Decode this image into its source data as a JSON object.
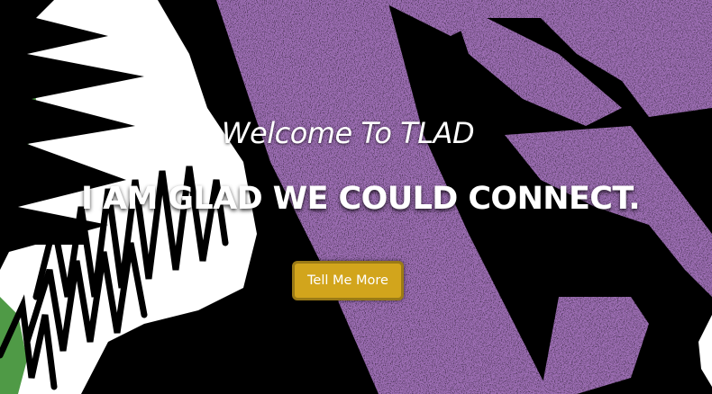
{
  "hero": {
    "welcome_text": "Welcome To TLAD",
    "headline": "I AM GLAD WE COULD CONNECT.",
    "cta_label": "Tell Me More"
  },
  "colors": {
    "purple": "#9e6fb5",
    "green": "#4f9a46",
    "white": "#ffffff",
    "black": "#000000",
    "cta_gold": "#d2a51c"
  }
}
